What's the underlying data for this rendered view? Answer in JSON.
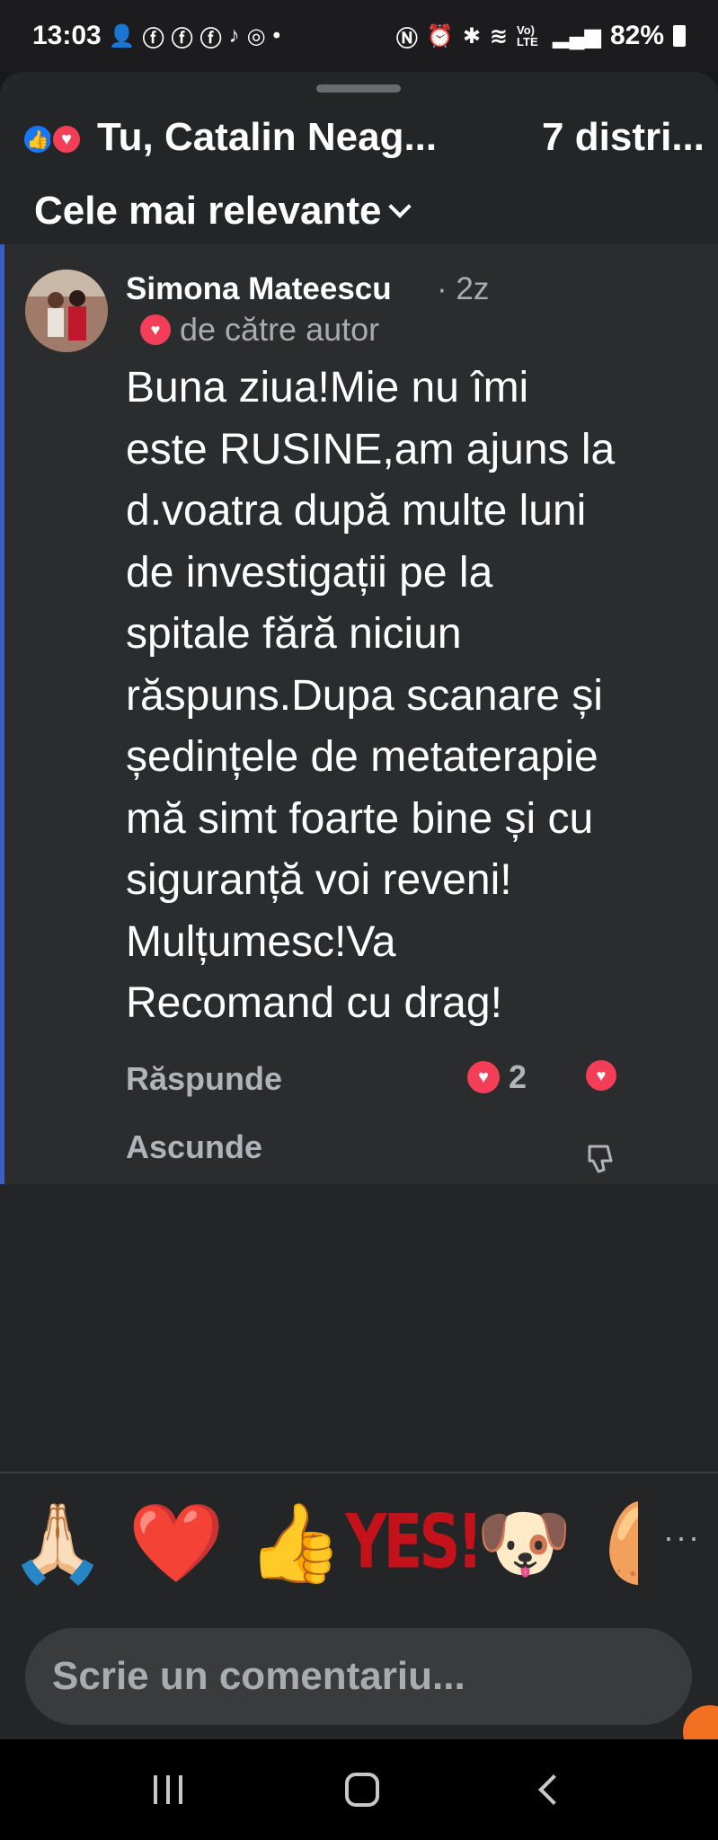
{
  "status_bar": {
    "time": "13:03",
    "battery": "82%",
    "left_icons": [
      "person-add-icon",
      "facebook-icon",
      "facebook-icon",
      "facebook-icon",
      "tiktok-icon",
      "instagram-icon",
      "dot-icon"
    ],
    "right_icons": [
      "nfc-icon",
      "alarm-icon",
      "bluetooth-icon",
      "wifi-icon",
      "volte-icon",
      "signal-icon",
      "battery-icon"
    ],
    "volte_label": "Vo) LTE"
  },
  "header": {
    "reaction_icons": [
      "like-icon",
      "love-icon"
    ],
    "reactors": "Tu, Catalin Neag...",
    "shares": "7 distri...",
    "sort_label": "Cele mai relevante"
  },
  "comment": {
    "author": "Simona Mateescu",
    "time": "· 2z",
    "loved_by": "de către autor",
    "lines": [
      "Buna ziua!Mie nu îmi",
      "este RUSINE,am ajuns la",
      "d.voatra după multe luni",
      "de investigații pe la",
      "spitale fără niciun",
      "răspuns.Dupa scanare și",
      "ședințele de metaterapie",
      "mă simt foarte bine și cu",
      "siguranță voi reveni!",
      "Mulțumesc!Va",
      "Recomand cu drag!"
    ],
    "reply_label": "Răspunde",
    "reaction_count": "2",
    "hide_label": "Ascunde"
  },
  "emoji_bar": {
    "items": [
      "🙏🏻",
      "❤️",
      "👍",
      "YES!",
      "🐶",
      "🥚"
    ],
    "more": "···"
  },
  "composer": {
    "placeholder": "Scrie un comentariu..."
  },
  "colors": {
    "background": "#242526",
    "comment_bg": "#2b2c2e",
    "accent_bar": "#3b5fc2",
    "love": "#f33e58",
    "like": "#1877f2"
  }
}
